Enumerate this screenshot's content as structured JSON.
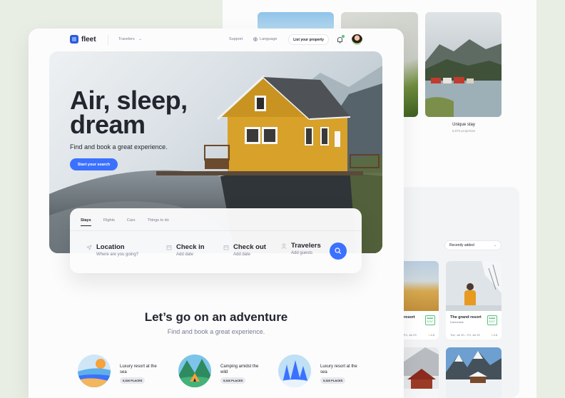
{
  "back": {
    "unique_stay": {
      "title": "Unique stay",
      "sub": "6,879 properties"
    },
    "sort_select": "Recently added",
    "cards": [
      {
        "title": "The grand resort",
        "sub": "Karineside",
        "price_top": "$356",
        "price_bottom": "$267",
        "dates": "Tue, Jul 20 – Fri, Jul 23",
        "rating": "4.8"
      }
    ],
    "partial_card": {
      "title": "resort",
      "price_top": "$356",
      "price_bottom": "$267",
      "dates": "Fri, Jul 23",
      "rating": "4.8"
    }
  },
  "nav": {
    "logo": "fleet",
    "travelers": "Travelers",
    "support": "Support",
    "language": "Language",
    "list_property": "List your property"
  },
  "hero": {
    "title": "Air, sleep, dream",
    "subtitle": "Find and book a great experience.",
    "cta": "Start your search"
  },
  "search": {
    "tabs": [
      "Stays",
      "Flights",
      "Cars",
      "Things to do"
    ],
    "fields": [
      {
        "label": "Location",
        "placeholder": "Where are you going?"
      },
      {
        "label": "Check in",
        "placeholder": "Add date"
      },
      {
        "label": "Check out",
        "placeholder": "Add date"
      },
      {
        "label": "Travelers",
        "placeholder": "Add guests"
      }
    ]
  },
  "adventure": {
    "title": "Let’s go on an adventure",
    "subtitle": "Find and book a great experience.",
    "categories": [
      {
        "title": "Luxury resort at the sea",
        "badge": "9,326 PLACES"
      },
      {
        "title": "Camping amidst the wild",
        "badge": "9,326 PLACES"
      },
      {
        "title": "Luxury resort at the sea",
        "badge": "9,326 PLACES"
      }
    ]
  }
}
